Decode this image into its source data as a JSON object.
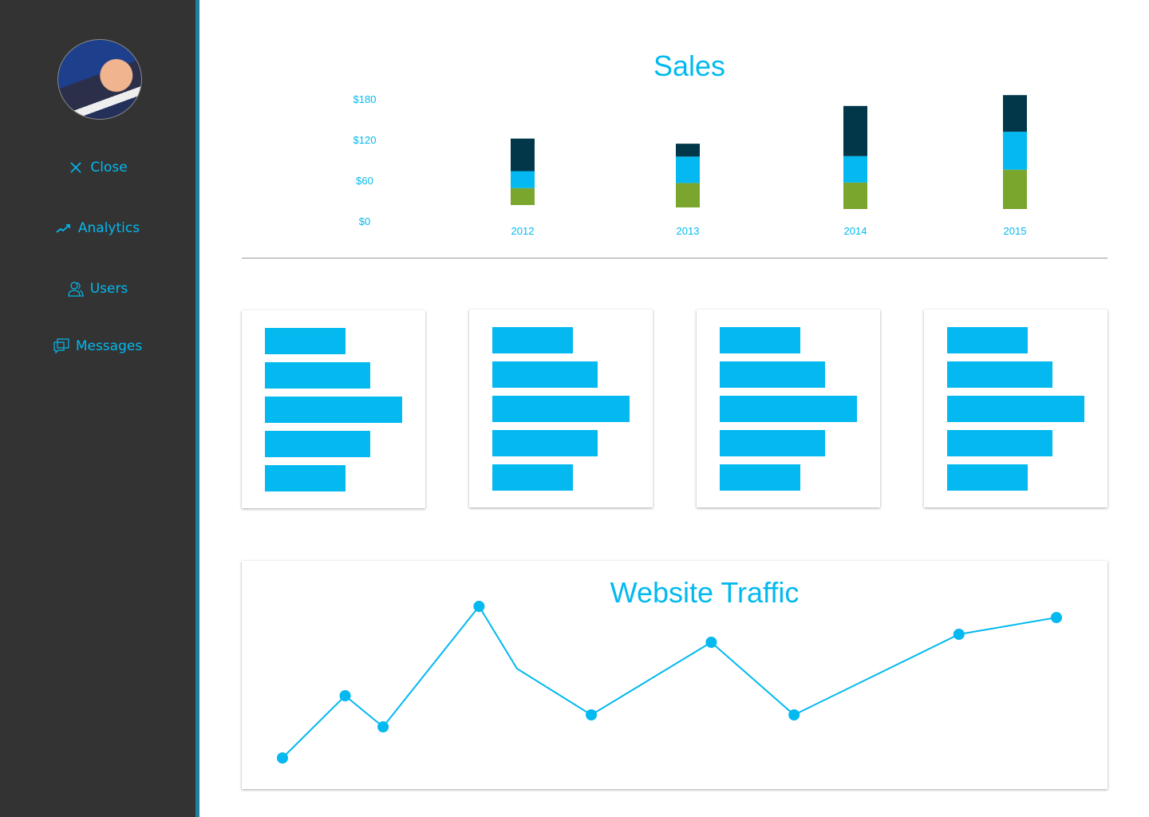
{
  "sidebar": {
    "items": [
      {
        "label": "Close",
        "icon": "close-icon"
      },
      {
        "label": "Analytics",
        "icon": "trend-up-icon"
      },
      {
        "label": "Users",
        "icon": "users-icon"
      },
      {
        "label": "Messages",
        "icon": "messages-icon"
      }
    ]
  },
  "colors": {
    "accent": "#03b9ef",
    "dark": "#023749",
    "green": "#7ba62e",
    "sidebar": "#333333"
  },
  "chart_data": [
    {
      "type": "bar",
      "stacked": true,
      "title": "Sales",
      "categories": [
        "2012",
        "2013",
        "2014",
        "2015"
      ],
      "yticks": [
        "$0",
        "$60",
        "$120",
        "$180"
      ],
      "ylim": [
        0,
        180
      ],
      "series": [
        {
          "color": "#7ba62e",
          "values": [
            25,
            36,
            39,
            58
          ]
        },
        {
          "color": "#03b9ef",
          "values": [
            25,
            39,
            39,
            56
          ]
        },
        {
          "color": "#023749",
          "values": [
            48,
            19,
            74,
            54
          ]
        }
      ]
    },
    {
      "type": "bar",
      "orientation": "horizontal",
      "values": [
        0.59,
        0.77,
        1,
        0.77,
        0.59
      ]
    },
    {
      "type": "bar",
      "orientation": "horizontal",
      "values": [
        0.59,
        0.77,
        1,
        0.77,
        0.59
      ]
    },
    {
      "type": "bar",
      "orientation": "horizontal",
      "values": [
        0.59,
        0.77,
        1,
        0.77,
        0.59
      ]
    },
    {
      "type": "bar",
      "orientation": "horizontal",
      "values": [
        0.59,
        0.77,
        1,
        0.77,
        0.59
      ]
    },
    {
      "type": "line",
      "title": "Website Traffic",
      "x": [
        0,
        8.1,
        13,
        25.4,
        30.3,
        39.9,
        55.4,
        66.1,
        87.4,
        100
      ],
      "y": [
        40,
        118,
        79,
        230,
        152,
        94,
        185,
        94,
        195,
        216
      ],
      "markers": [
        true,
        true,
        true,
        true,
        false,
        true,
        true,
        true,
        true,
        true
      ]
    }
  ]
}
